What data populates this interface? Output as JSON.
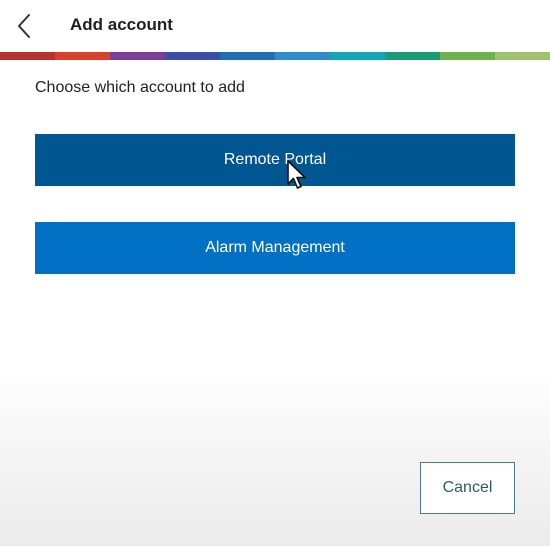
{
  "header": {
    "title": "Add account",
    "back_icon": "chevron-left-icon"
  },
  "brand_stripe": {
    "colors": [
      "#b8312f",
      "#d8412b",
      "#7b3f97",
      "#3a4fa3",
      "#1f6fb6",
      "#2e8bd0",
      "#15a6b5",
      "#1a9b78",
      "#6fb24e",
      "#9fc36a"
    ]
  },
  "main": {
    "prompt": "Choose which account to add",
    "options": [
      {
        "label": "Remote Portal",
        "color": "#005691"
      },
      {
        "label": "Alarm Management",
        "color": "#0070c4"
      }
    ]
  },
  "footer": {
    "cancel_label": "Cancel"
  },
  "colors": {
    "text": "#1f1f1f",
    "cancel_border": "#4a7a8c",
    "cancel_text": "#2d5a72"
  },
  "pointer": {
    "icon": "mouse-pointer-icon"
  }
}
